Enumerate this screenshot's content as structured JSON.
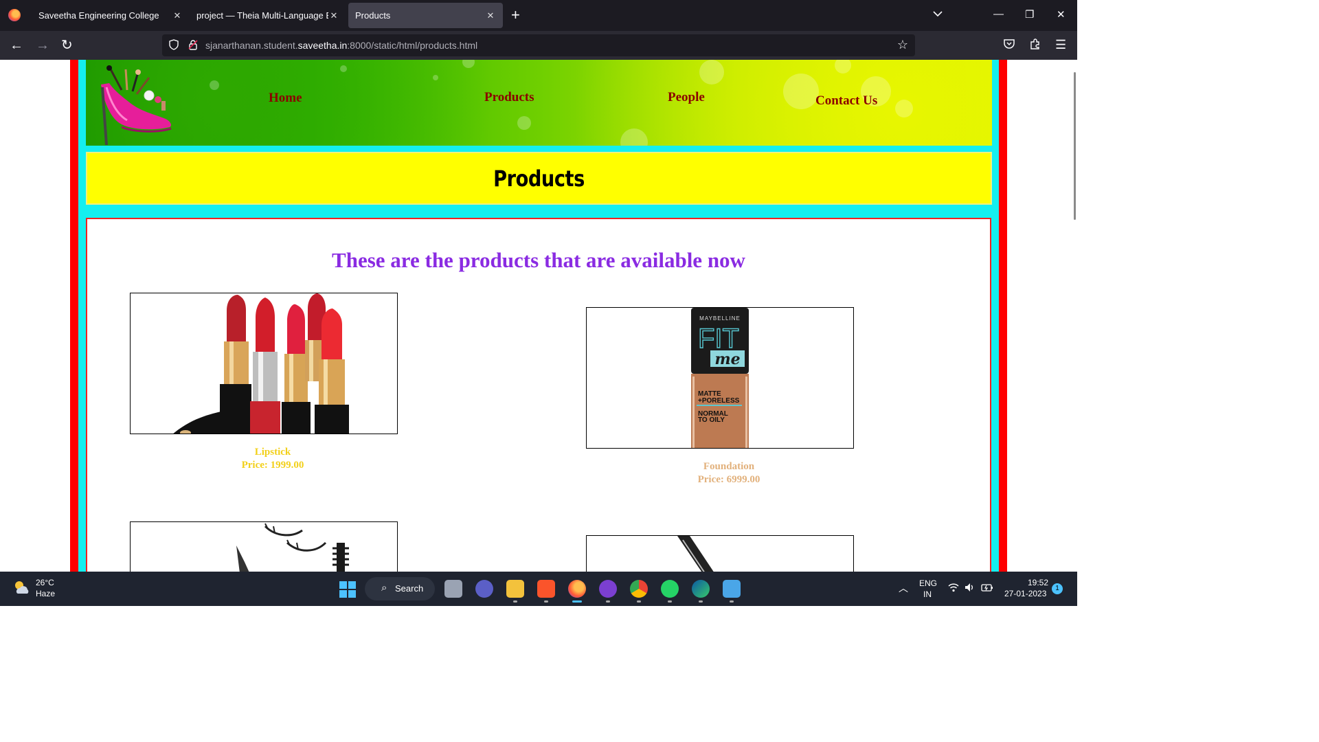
{
  "browser": {
    "tabs": [
      {
        "title": "Saveetha Engineering College"
      },
      {
        "title": "project — Theia Multi-Language Ex"
      },
      {
        "title": "Products"
      }
    ],
    "url": {
      "prefix": "sjanarthanan.student.",
      "domain": "saveetha.in",
      "suffix": ":8000/static/html/products.html"
    }
  },
  "site": {
    "nav": [
      "Home",
      "Products",
      "People",
      "Contact Us"
    ],
    "page_title": "Products",
    "heading": "These are the products that are available now",
    "products": [
      {
        "name": "Lipstick",
        "price": "Price: 1999.00",
        "color": "#f2d01a"
      },
      {
        "name": "Foundation",
        "price": "Price: 6999.00",
        "color": "#e2b17c"
      }
    ],
    "foundation_label": {
      "brand": "MAYBELLINE",
      "line1": "FIT",
      "line2": "me",
      "line3": "MATTE",
      "line4": "+PORELESS",
      "line5": "NORMAL",
      "line6": "TO OILY"
    }
  },
  "taskbar": {
    "weather_temp": "26°C",
    "weather_cond": "Haze",
    "search_label": "Search",
    "lang1": "ENG",
    "lang2": "IN",
    "time": "19:52",
    "date": "27-01-2023",
    "notifications": "1"
  }
}
